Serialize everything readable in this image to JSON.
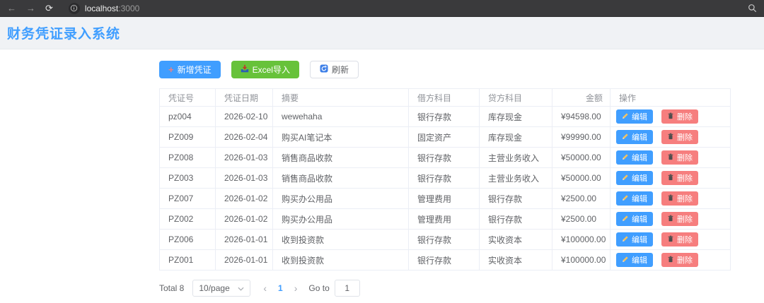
{
  "browser": {
    "url_host": "localhost",
    "url_port": ":3000"
  },
  "icons": {
    "back": "←",
    "forward": "→",
    "reload": "⟳",
    "refresh_glyph": "⟳",
    "add_plus": "+",
    "prev": "‹",
    "next": "›"
  },
  "header": {
    "title": "财务凭证录入系统"
  },
  "toolbar": {
    "add_label": "新增凭证",
    "import_label": "Excel导入",
    "refresh_label": "刷新"
  },
  "table": {
    "columns": [
      "凭证号",
      "凭证日期",
      "摘要",
      "借方科目",
      "贷方科目",
      "金额",
      "操作"
    ],
    "edit_label": "编辑",
    "delete_label": "删除",
    "rows": [
      {
        "id": "pz004",
        "date": "2026-02-10",
        "summary": "wewehaha",
        "debit": "银行存款",
        "credit": "库存现金",
        "amount": "¥94598.00"
      },
      {
        "id": "PZ009",
        "date": "2026-02-04",
        "summary": "购买AI笔记本",
        "debit": "固定资产",
        "credit": "库存现金",
        "amount": "¥99990.00"
      },
      {
        "id": "PZ008",
        "date": "2026-01-03",
        "summary": "销售商品收款",
        "debit": "银行存款",
        "credit": "主营业务收入",
        "amount": "¥50000.00"
      },
      {
        "id": "PZ003",
        "date": "2026-01-03",
        "summary": "销售商品收款",
        "debit": "银行存款",
        "credit": "主营业务收入",
        "amount": "¥50000.00"
      },
      {
        "id": "PZ007",
        "date": "2026-01-02",
        "summary": "购买办公用品",
        "debit": "管理费用",
        "credit": "银行存款",
        "amount": "¥2500.00"
      },
      {
        "id": "PZ002",
        "date": "2026-01-02",
        "summary": "购买办公用品",
        "debit": "管理费用",
        "credit": "银行存款",
        "amount": "¥2500.00"
      },
      {
        "id": "PZ006",
        "date": "2026-01-01",
        "summary": "收到投资款",
        "debit": "银行存款",
        "credit": "实收资本",
        "amount": "¥100000.00"
      },
      {
        "id": "PZ001",
        "date": "2026-01-01",
        "summary": "收到投资款",
        "debit": "银行存款",
        "credit": "实收资本",
        "amount": "¥100000.00"
      }
    ]
  },
  "pagination": {
    "total_label": "Total 8",
    "page_size": "10/page",
    "current_page": "1",
    "goto_label": "Go to",
    "goto_value": "1"
  },
  "colors": {
    "primary": "#409EFF",
    "success": "#67C23A",
    "danger": "#F56C6C",
    "title_blue": "#409EFF",
    "header_band": "#f0f2f5",
    "table_border": "#ebeef5",
    "chrome_bar": "#3a3a3c"
  }
}
